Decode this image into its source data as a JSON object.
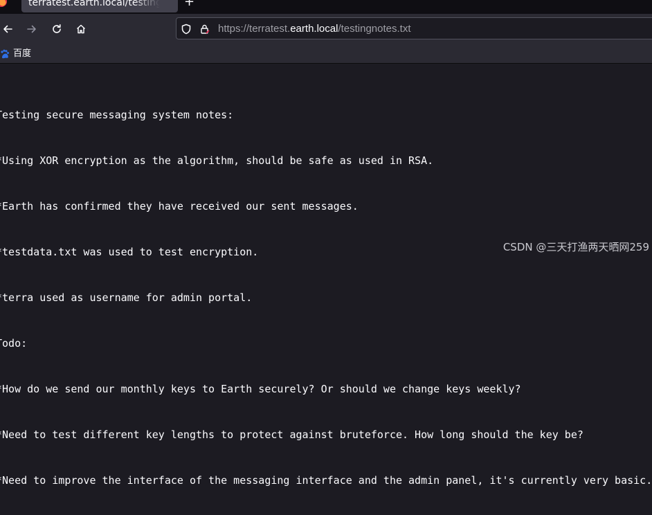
{
  "tab": {
    "title": "terratest.earth.local/testingnotes.txt",
    "new_tab_label": "+"
  },
  "navigation": {
    "back_icon": "arrow-left-icon",
    "forward_icon": "arrow-right-icon",
    "reload_icon": "reload-icon",
    "home_icon": "home-icon"
  },
  "urlbar": {
    "scheme": "https://terratest.",
    "host": "earth.local",
    "path": "/testingnotes.txt",
    "shield_icon": "shield-icon",
    "lock_icon": "lock-icon"
  },
  "bookmarks": [
    {
      "label": "百度",
      "icon": "baidu-icon"
    }
  ],
  "document": {
    "lines": [
      "Testing secure messaging system notes:",
      "*Using XOR encryption as the algorithm, should be safe as used in RSA.",
      "*Earth has confirmed they have received our sent messages.",
      "*testdata.txt was used to test encryption.",
      "*terra used as username for admin portal.",
      "Todo:",
      "*How do we send our monthly keys to Earth securely? Or should we change keys weekly?",
      "*Need to test different key lengths to protect against bruteforce. How long should the key be?",
      "*Need to improve the interface of the messaging interface and the admin panel, it's currently very basic."
    ]
  },
  "watermark": "CSDN @三天打渔两天晒网259",
  "colors": {
    "tabbar_bg": "#0f0e13",
    "toolbar_bg": "#2b2a33",
    "content_bg": "#1c1b22",
    "text": "#fbfbfe",
    "muted_text": "#9f9fa6"
  }
}
